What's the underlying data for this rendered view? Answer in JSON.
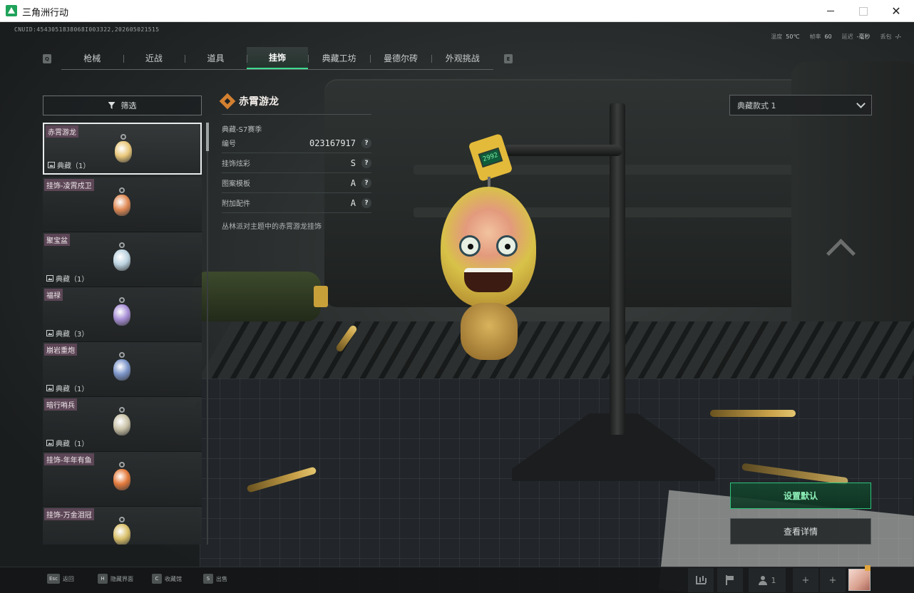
{
  "window": {
    "title": "三角洲行动",
    "minimize": "",
    "maximize": "",
    "close": "✕"
  },
  "hud": {
    "uid": "CNUID:4543051838068I003322,202605021515",
    "stats": [
      {
        "label": "温度",
        "value": "50℃"
      },
      {
        "label": "帧率",
        "value": "60"
      },
      {
        "label": "延迟",
        "value": "-毫秒"
      },
      {
        "label": "丢包",
        "value": "-/-"
      }
    ]
  },
  "tabs": {
    "key_prev": "Q",
    "key_next": "E",
    "items": [
      "枪械",
      "近战",
      "道具",
      "挂饰",
      "典藏工坊",
      "曼德尔砖",
      "外观挑战"
    ],
    "active": "挂饰"
  },
  "filter": {
    "label": "筛选"
  },
  "list": [
    {
      "name": "赤霄游龙",
      "badge": "典藏（1）",
      "color": "#e9c77a",
      "selected": true
    },
    {
      "name": "挂饰-凌霄戍卫",
      "badge": "",
      "color": "#e08a55",
      "selected": false
    },
    {
      "name": "聚宝盆",
      "badge": "典藏（1）",
      "color": "#bcd3e0",
      "selected": false
    },
    {
      "name": "福禄",
      "badge": "典藏（3）",
      "color": "#a88fd6",
      "selected": false
    },
    {
      "name": "崩岩重炮",
      "badge": "典藏（1）",
      "color": "#7c95c9",
      "selected": false
    },
    {
      "name": "暗行哨兵",
      "badge": "典藏（1）",
      "color": "#c9c2a8",
      "selected": false
    },
    {
      "name": "挂饰-年年有鱼",
      "badge": "",
      "color": "#e47a3c",
      "selected": false
    },
    {
      "name": "挂饰-万金泪冠",
      "badge": "",
      "color": "#d9c06a",
      "selected": false
    }
  ],
  "detail": {
    "title": "赤霄游龙",
    "season": "典藏-S7赛季",
    "rows": [
      {
        "label": "编号",
        "value": "023167917"
      },
      {
        "label": "挂饰炫彩",
        "value": "S"
      },
      {
        "label": "图案模板",
        "value": "A"
      },
      {
        "label": "附加配件",
        "value": "A"
      }
    ],
    "help": "?",
    "description": "丛林派对主题中的赤霄游龙挂饰"
  },
  "charm": {
    "tag_text": "2992"
  },
  "style_select": {
    "value": "典藏款式 1"
  },
  "actions": {
    "set_default": "设置默认",
    "view_details": "查看详情"
  },
  "bottom": {
    "hints": [
      {
        "key": "Esc",
        "label": "返回"
      },
      {
        "key": "H",
        "label": "隐藏界面"
      },
      {
        "key": "C",
        "label": "收藏馆"
      },
      {
        "key": "S",
        "label": "出售"
      }
    ],
    "party_count": "1",
    "add": "+"
  },
  "colors": {
    "accent": "#3edc90",
    "item_name_bg": "#5c4656",
    "panel_bg": "#1e2122"
  }
}
